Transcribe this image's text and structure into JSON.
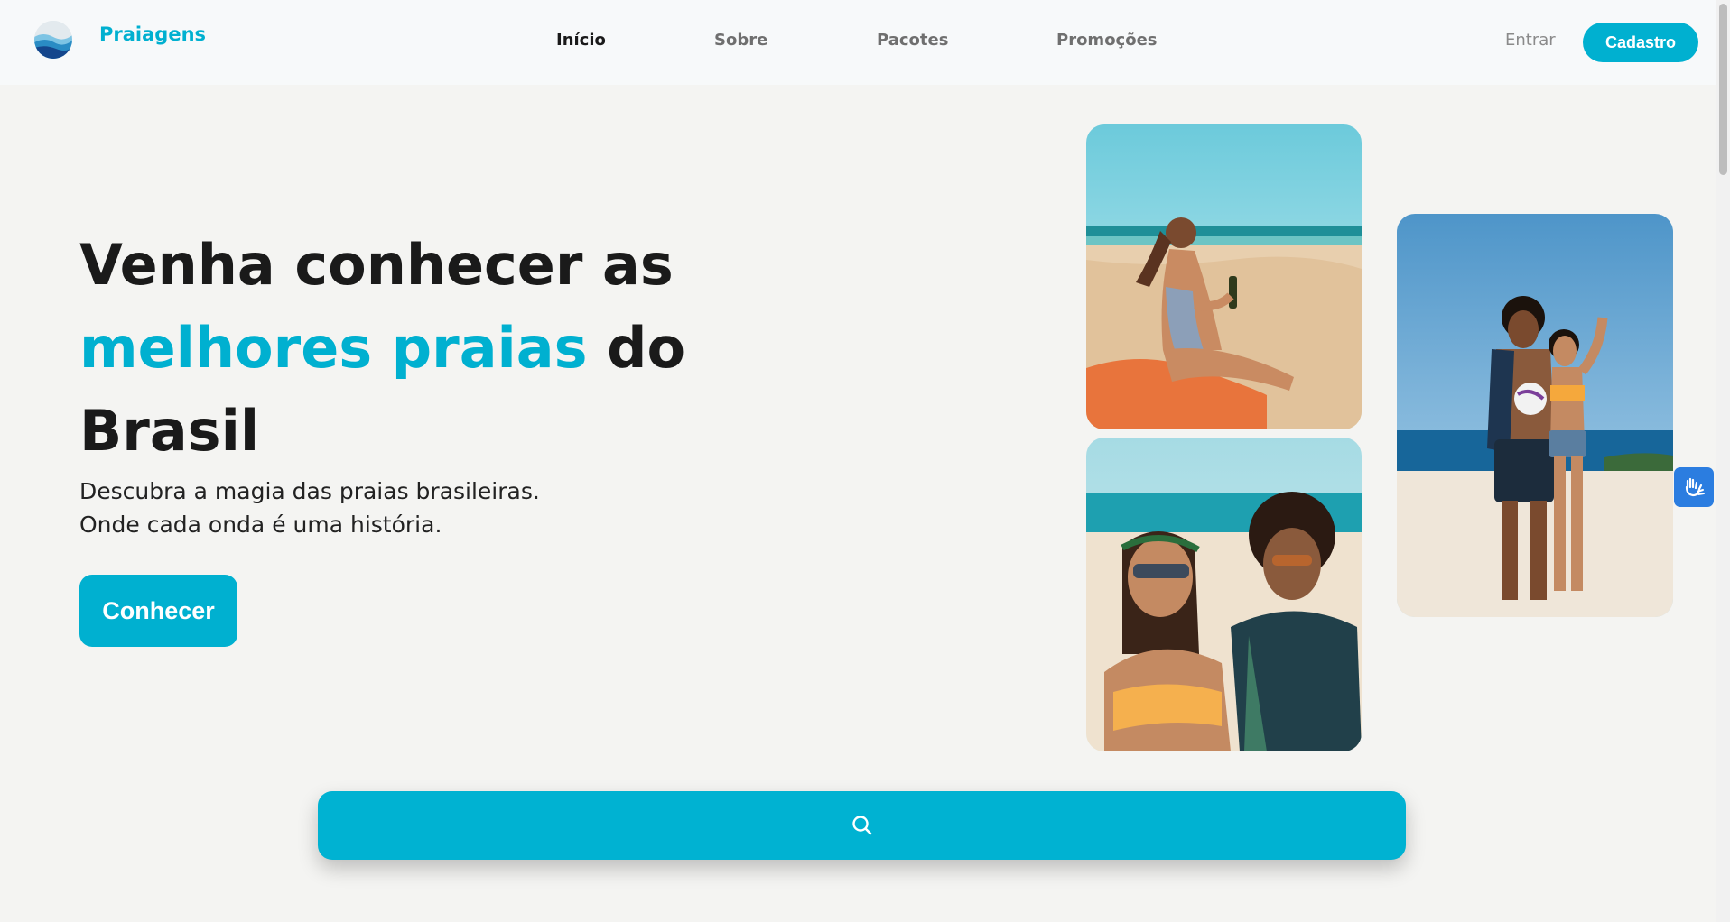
{
  "brand": {
    "name": "Praiagens"
  },
  "nav": {
    "items": [
      {
        "label": "Início",
        "active": true
      },
      {
        "label": "Sobre",
        "active": false
      },
      {
        "label": "Pacotes",
        "active": false
      },
      {
        "label": "Promoções",
        "active": false
      }
    ],
    "login_label": "Entrar",
    "signup_label": "Cadastro"
  },
  "hero": {
    "title_part1": "Venha conhecer as",
    "title_highlight": "melhores praias",
    "title_part2": "do",
    "title_part3": "Brasil",
    "subtitle_line1": "Descubra a magia das praias brasileiras.",
    "subtitle_line2": "Onde cada onda é uma história.",
    "cta_label": "Conhecer"
  },
  "gallery": {
    "photos": [
      {
        "name": "woman-on-beach-photo"
      },
      {
        "name": "couple-selfie-photo"
      },
      {
        "name": "couple-with-volleyball-photo"
      }
    ]
  },
  "search": {
    "icon": "search-icon"
  },
  "accessibility": {
    "icon": "sign-language-icon"
  },
  "colors": {
    "accent": "#00b0d0",
    "background": "#f4f4f2",
    "header_bg": "#f7f9fa",
    "a11y_blue": "#2b7de0"
  }
}
